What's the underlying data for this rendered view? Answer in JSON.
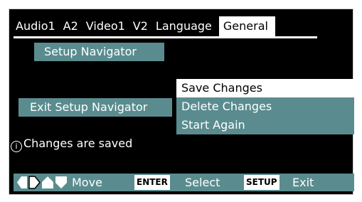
{
  "tabs": [
    "Audio1",
    "A2",
    "Video1",
    "V2",
    "Language",
    "General"
  ],
  "active_tab": "General",
  "setup_navigator_label": "Setup Navigator",
  "exit_navigator_label": "Exit Setup Navigator",
  "menu": {
    "items": [
      "Save Changes",
      "Delete Changes",
      "Start Again"
    ],
    "selected": "Save Changes"
  },
  "status": {
    "icon": "info-icon",
    "text": "Changes are saved"
  },
  "footer": {
    "move_label": "Move",
    "enter_key": "ENTER",
    "select_label": "Select",
    "setup_key": "SETUP",
    "exit_label": "Exit"
  },
  "colors": {
    "background": "#000000",
    "button_teal": "#5a8c8f",
    "highlight": "#ffffff",
    "text": "#ffffff"
  }
}
